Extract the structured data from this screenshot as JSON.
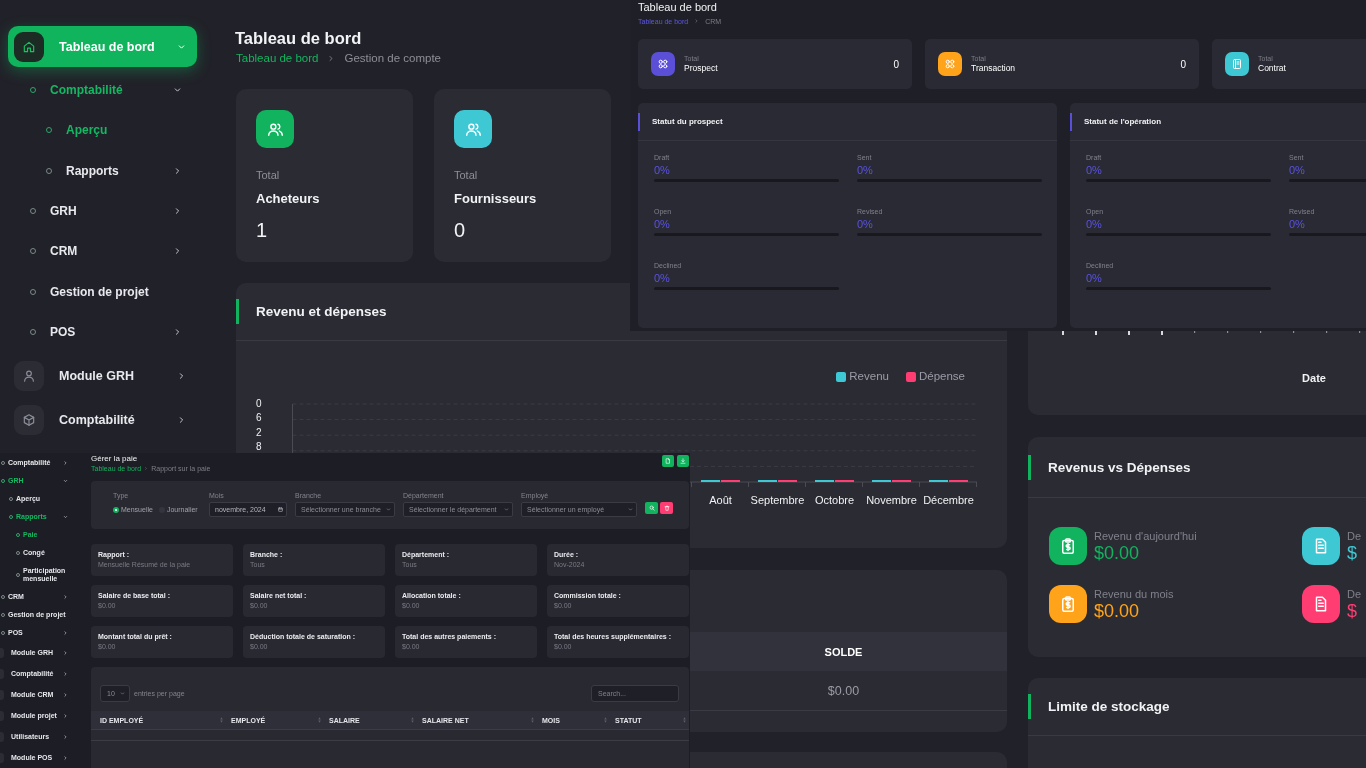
{
  "sidebar": {
    "items": [
      {
        "label": "Tableau de bord",
        "kind": "module",
        "selected": true,
        "expanded": true,
        "children": [
          {
            "label": "Comptabilité",
            "kind": "group",
            "selected": true,
            "expanded": true,
            "children": [
              {
                "label": "Aperçu",
                "kind": "link",
                "selected": true
              },
              {
                "label": "Rapports",
                "kind": "group",
                "selected": false,
                "expanded": false
              }
            ]
          },
          {
            "label": "GRH",
            "kind": "group",
            "selected": false,
            "expanded": false
          },
          {
            "label": "CRM",
            "kind": "group",
            "selected": false,
            "expanded": false
          },
          {
            "label": "Gestion de projet",
            "kind": "link",
            "selected": false
          },
          {
            "label": "POS",
            "kind": "group",
            "selected": false,
            "expanded": false
          }
        ]
      },
      {
        "label": "Module GRH",
        "kind": "module",
        "selected": false,
        "expanded": false
      },
      {
        "label": "Comptabilité",
        "kind": "module",
        "selected": false,
        "expanded": false
      }
    ]
  },
  "header": {
    "title": "Tableau de bord",
    "breadcrumb": [
      "Tableau de bord",
      "Gestion de compte"
    ]
  },
  "stats": [
    {
      "caption": "Total",
      "label": "Acheteurs",
      "value": "1",
      "color": "#12b35e"
    },
    {
      "caption": "Total",
      "label": "Fournisseurs",
      "value": "0",
      "color": "#3ec8d4"
    }
  ],
  "income_chart": {
    "title": "Revenu et dépenses",
    "legend": [
      {
        "name": "Revenu",
        "color": "#3ec8d4"
      },
      {
        "name": "Dépense",
        "color": "#ff3d73"
      }
    ],
    "y_labels": [
      "0",
      "6",
      "2",
      "8"
    ],
    "x_labels": [
      "Août",
      "Septembre",
      "Octobre",
      "Novembre",
      "Décembre"
    ]
  },
  "balance_table": {
    "columns": [
      "SOLDE"
    ],
    "rows": [
      [
        "$0.00"
      ]
    ]
  },
  "date_chart": {
    "xlabel": "Date"
  },
  "revenue_vs_expense": {
    "title": "Revenus vs Dépenses",
    "items": [
      {
        "kind": "income",
        "label": "Revenu d'aujourd'hui",
        "value": "$0.00",
        "color": "#12b35e"
      },
      {
        "kind": "expense",
        "label": "De",
        "value": "$",
        "color": "#3ec8d4"
      },
      {
        "kind": "income",
        "label": "Revenu du mois",
        "value": "$0.00",
        "color": "#ffa31a"
      },
      {
        "kind": "expense",
        "label": "De",
        "value": "$",
        "color": "#ff3d73"
      }
    ]
  },
  "storage": {
    "title": "Limite de stockage"
  },
  "crm_screen": {
    "title": "Tableau de bord",
    "breadcrumb": [
      "Tableau de bord",
      "CRM"
    ],
    "stats": [
      {
        "caption": "Total",
        "label": "Prospect",
        "value": "0",
        "color": "#5b4fd8"
      },
      {
        "caption": "Total",
        "label": "Transaction",
        "value": "0",
        "color": "#ffa31a"
      },
      {
        "caption": "Total",
        "label": "Contrat",
        "color": "#3ec8d4"
      }
    ],
    "panels": [
      {
        "title": "Statut du prospect",
        "stats": [
          {
            "label": "Draft",
            "reading": "0%",
            "level": 0
          },
          {
            "label": "Sent",
            "reading": "0%",
            "level": 0
          },
          {
            "label": "Open",
            "reading": "0%",
            "level": 0
          },
          {
            "label": "Revised",
            "reading": "0%",
            "level": 0
          },
          {
            "label": "Declined",
            "reading": "0%",
            "level": 0
          }
        ]
      },
      {
        "title": "Statut de l'opération",
        "stats": [
          {
            "label": "Draft",
            "reading": "0%",
            "level": 0
          },
          {
            "label": "Sent",
            "reading": "0%",
            "level": 0
          },
          {
            "label": "Open",
            "reading": "0%",
            "level": 0
          },
          {
            "label": "Revised",
            "reading": "0%",
            "level": 0
          },
          {
            "label": "Declined",
            "reading": "0%",
            "level": 0
          }
        ]
      }
    ]
  },
  "payroll_screen": {
    "sidebar": {
      "items": [
        {
          "label": "Comptabilité",
          "kind": "group",
          "selected": false,
          "expanded": false
        },
        {
          "label": "GRH",
          "kind": "group",
          "selected": true,
          "expanded": true,
          "children": [
            {
              "label": "Aperçu",
              "kind": "link",
              "selected": false
            },
            {
              "label": "Rapports",
              "kind": "group",
              "selected": true,
              "expanded": true,
              "children": [
                {
                  "label": "Paie",
                  "kind": "link",
                  "selected": true
                },
                {
                  "label": "Congé",
                  "kind": "link",
                  "selected": false
                },
                {
                  "label": "Participation mensuelle",
                  "kind": "link",
                  "selected": false
                }
              ]
            }
          ]
        },
        {
          "label": "CRM",
          "kind": "group",
          "selected": false,
          "expanded": false
        },
        {
          "label": "Gestion de projet",
          "kind": "link",
          "selected": false
        },
        {
          "label": "POS",
          "kind": "group",
          "selected": false,
          "expanded": false
        },
        {
          "label": "Module GRH",
          "kind": "module",
          "selected": false,
          "expanded": false
        },
        {
          "label": "Comptabilité",
          "kind": "module",
          "selected": false,
          "expanded": false
        },
        {
          "label": "Module CRM",
          "kind": "module",
          "selected": false,
          "expanded": false
        },
        {
          "label": "Module projet",
          "kind": "module",
          "selected": false,
          "expanded": false
        },
        {
          "label": "Utilisateurs",
          "kind": "module",
          "selected": false,
          "expanded": false
        },
        {
          "label": "Module POS",
          "kind": "module",
          "selected": false,
          "expanded": false
        }
      ]
    },
    "title": "Gérer la paie",
    "breadcrumb": [
      "Tableau de bord",
      "Rapport sur la paie"
    ],
    "filters": {
      "type_label": "Type",
      "type_options": [
        {
          "label": "Mensuelle",
          "selected": true
        },
        {
          "label": "Journalier",
          "selected": false
        }
      ],
      "fields": [
        {
          "kind": "date",
          "label": "Mois",
          "value": "novembre, 2024"
        },
        {
          "kind": "select",
          "label": "Branche",
          "placeholder": "Sélectionner une branche"
        },
        {
          "kind": "select",
          "label": "Département",
          "placeholder": "Sélectionner le département"
        },
        {
          "kind": "select",
          "label": "Employé",
          "placeholder": "Sélectionner un employé"
        }
      ]
    },
    "summary": [
      {
        "label": "Rapport :",
        "value": "Mensuelle Résumé de la paie"
      },
      {
        "label": "Branche :",
        "value": "Tous"
      },
      {
        "label": "Département :",
        "value": "Tous"
      },
      {
        "label": "Durée :",
        "value": "Nov-2024"
      },
      {
        "label": "Salaire de base total :",
        "value": "$0.00"
      },
      {
        "label": "Salaire net total :",
        "value": "$0.00"
      },
      {
        "label": "Allocation totale :",
        "value": "$0.00"
      },
      {
        "label": "Commission totale :",
        "value": "$0.00"
      },
      {
        "label": "Montant total du prêt :",
        "value": "$0.00"
      },
      {
        "label": "Déduction totale de saturation :",
        "value": "$0.00"
      },
      {
        "label": "Total des autres paiements :",
        "value": "$0.00"
      },
      {
        "label": "Total des heures supplémentaires :",
        "value": "$0.00"
      }
    ],
    "table": {
      "page_size": "10",
      "page_size_caption": "entries per page",
      "search": {
        "placeholder": "Search..."
      },
      "columns": [
        "ID EMPLOYÉ",
        "EMPLOYÉ",
        "SALAIRE",
        "SALAIRE NET",
        "MOIS",
        "STATUT"
      ]
    }
  }
}
